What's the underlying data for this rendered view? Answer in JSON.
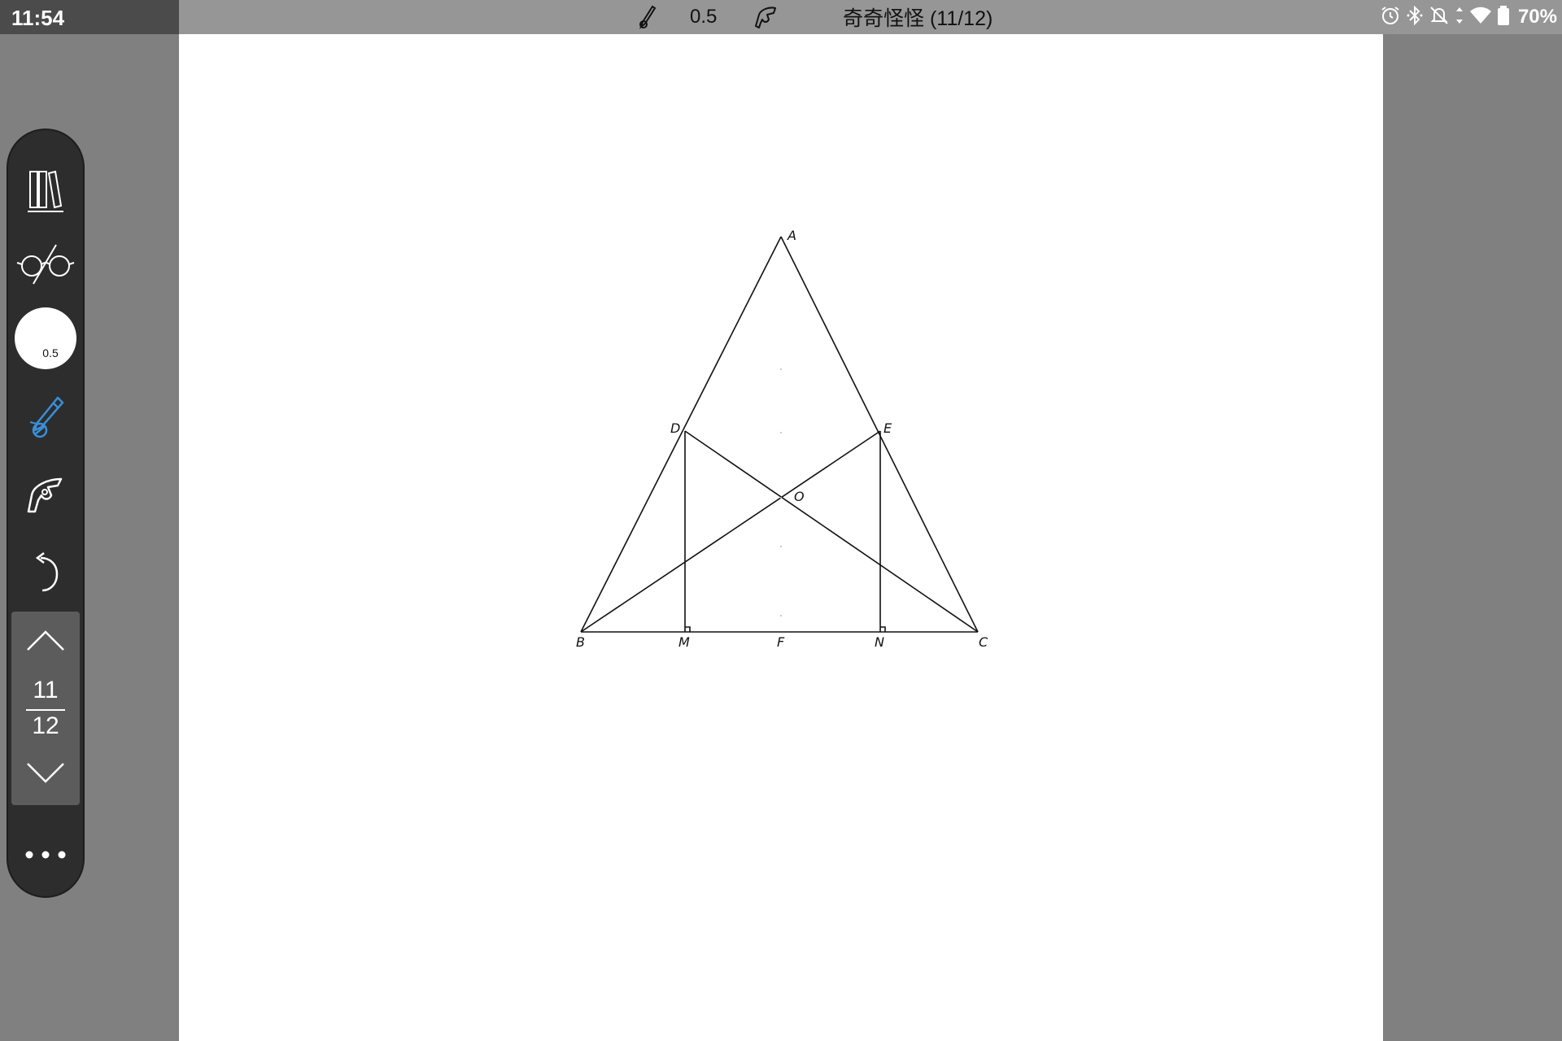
{
  "status_bar": {
    "time": "11:54",
    "pen_size": "0.5",
    "title": "奇奇怪怪 (11/12)",
    "battery": "70%"
  },
  "toolbar": {
    "pen_size": "0.5",
    "page_current": "11",
    "page_total": "12",
    "pen_color": "#3a8fd8"
  },
  "drawing": {
    "labels": {
      "A": "A",
      "B": "B",
      "C": "C",
      "D": "D",
      "E": "E",
      "F": "F",
      "M": "M",
      "N": "N",
      "O": "O"
    }
  }
}
